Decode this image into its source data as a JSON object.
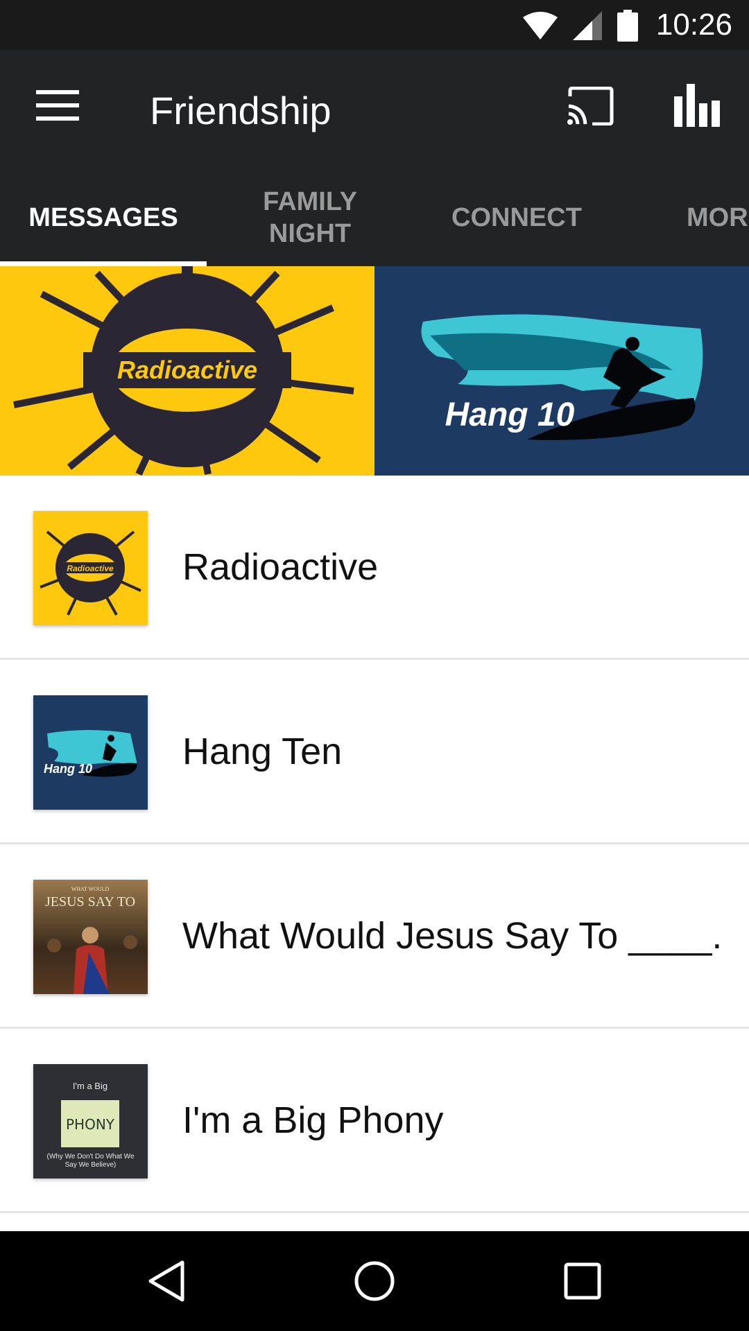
{
  "status_bar": {
    "time": "10:26"
  },
  "app_bar": {
    "title": "Friendship"
  },
  "tabs": [
    {
      "label": "MESSAGES"
    },
    {
      "label": "FAMILY NIGHT"
    },
    {
      "label": "CONNECT"
    },
    {
      "label": "MOR"
    }
  ],
  "banner": {
    "left": {
      "text": "Radioactive",
      "bg_color": "#fdc80e"
    },
    "right": {
      "text": "Hang 10",
      "bg_color": "#1d3a63"
    }
  },
  "messages": [
    {
      "title": "Radioactive",
      "thumb_text": "Radioactive"
    },
    {
      "title": "Hang Ten",
      "thumb_text": "Hang 10"
    },
    {
      "title": "What Would Jesus Say To ____...",
      "thumb_text_small": "WHAT WOULD",
      "thumb_text": "JESUS SAY TO"
    },
    {
      "title": "I'm a Big Phony",
      "thumb_text_top": "I'm a Big",
      "thumb_text": "PHONY",
      "thumb_text_bottom": "(Why We Don't Do What We Say We Believe)"
    }
  ],
  "colors": {
    "app_bar": "#222325",
    "status_bar": "#1a1a1a",
    "tab_inactive": "#9a9a9a",
    "tab_active": "#ffffff"
  }
}
